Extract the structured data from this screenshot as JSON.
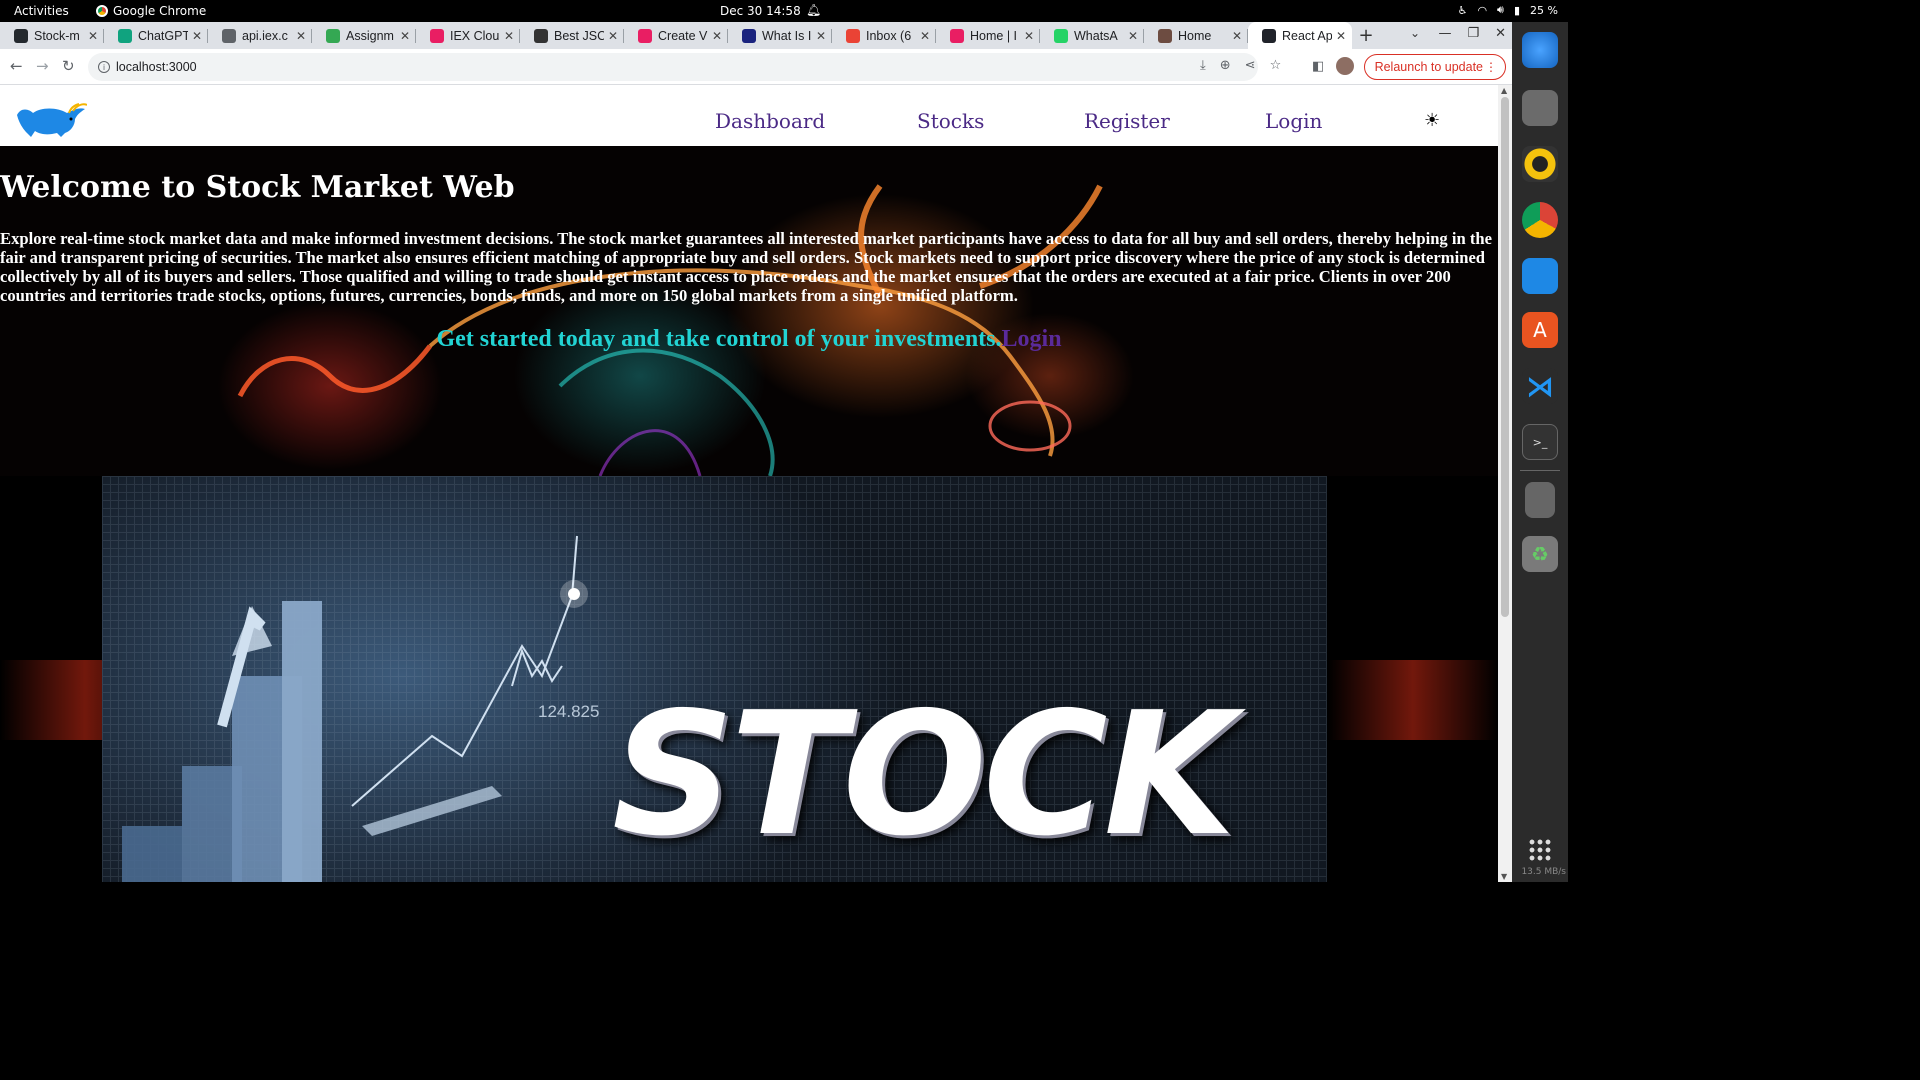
{
  "system": {
    "activities": "Activities",
    "app_name": "Google Chrome",
    "clock": "Dec 30  14:58",
    "battery": "25 %",
    "memory": "13.5 MB/s"
  },
  "browser": {
    "tabs": [
      {
        "label": "Stock-m",
        "icon": "github-icon",
        "color": "#24292e"
      },
      {
        "label": "ChatGPT",
        "icon": "chatgpt-icon",
        "color": "#10a37f"
      },
      {
        "label": "api.iex.c",
        "icon": "globe-icon",
        "color": "#5f6368"
      },
      {
        "label": "Assignm",
        "icon": "assignment-icon",
        "color": "#34a853"
      },
      {
        "label": "IEX Clou",
        "icon": "iex-icon",
        "color": "#e91e63"
      },
      {
        "label": "Best JSC",
        "icon": "cb-icon",
        "color": "#333333"
      },
      {
        "label": "Create V",
        "icon": "iex-icon",
        "color": "#e91e63"
      },
      {
        "label": "What Is I",
        "icon": "investopedia-icon",
        "color": "#1a237e"
      },
      {
        "label": "Inbox (6",
        "icon": "gmail-icon",
        "color": "#ea4335"
      },
      {
        "label": "Home | I",
        "icon": "iex-icon",
        "color": "#e91e63"
      },
      {
        "label": "WhatsA",
        "icon": "whatsapp-icon",
        "color": "#25d366"
      },
      {
        "label": "Home",
        "icon": "home-icon",
        "color": "#6d4c41"
      },
      {
        "label": "React Ap",
        "icon": "react-icon",
        "color": "#20232a"
      }
    ],
    "url": "localhost:3000",
    "relaunch": "Relaunch to update"
  },
  "nav": {
    "dashboard": "Dashboard",
    "stocks": "Stocks",
    "register": "Register",
    "login": "Login"
  },
  "hero": {
    "title": "Welcome to Stock Market Web",
    "description": "Explore real-time stock market data and make informed investment decisions. The stock market guarantees all interested market participants have access to data for all buy and sell orders, thereby helping in the fair and transparent pricing of securities. The market also ensures efficient matching of appropriate buy and sell orders. Stock markets need to support price discovery where the price of any stock is determined collectively by all of its buyers and sellers. Those qualified and willing to trade should get instant access to place orders and the market ensures that the orders are executed at a fair price. Clients in over 200 countries and territories trade stocks, options, futures, currencies, bonds, funds, and more on 150 global markets from a single unified platform.",
    "cta_text": "Get started today and take control of your investments.",
    "cta_link": "Login"
  },
  "promo": {
    "number": "124.825",
    "word": "STOCK"
  },
  "colors": {
    "nav_link": "#4b2a86",
    "cta_text": "#22d3d3",
    "cta_link": "#5a2a9a",
    "relaunch": "#d93025"
  }
}
